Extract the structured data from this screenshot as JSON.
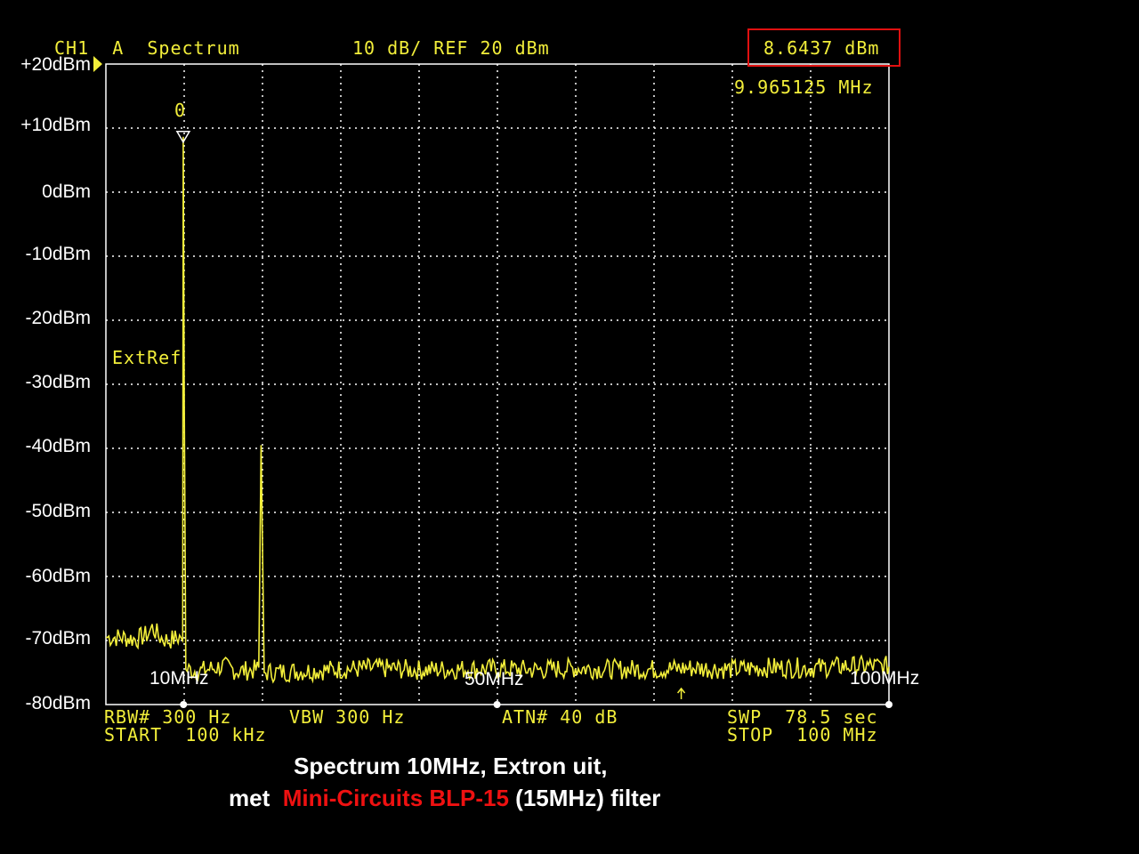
{
  "header": {
    "channel": "CH1",
    "mode": "A",
    "title": "Spectrum",
    "scale": "10 dB/ REF 20 dBm",
    "marker_level": "8.6437 dBm",
    "marker_freq": "9.965125 MHz",
    "marker_label": "0",
    "extref": "ExtRef"
  },
  "footer": {
    "rbw": "RBW# 300 Hz",
    "vbw": "VBW 300 Hz",
    "atn": "ATN# 40 dB",
    "swp": "SWP  78.5 sec",
    "start": "START  100 kHz",
    "stop": "STOP  100 MHz"
  },
  "caption": {
    "line1": "Spectrum 10MHz, Extron uit,",
    "line2_prefix": "met ",
    "line2_highlight": "Mini-Circuits BLP-15",
    "line2_suffix": " (15MHz) filter"
  },
  "colors": {
    "trace": "#f2ee3a",
    "grid": "#ffffff",
    "highlight": "#ee1111",
    "background": "#000000"
  },
  "chart_data": {
    "type": "line",
    "title": "Spectrum",
    "xlabel": "",
    "ylabel": "",
    "xlim": [
      0.1,
      100
    ],
    "ylim": [
      -80,
      20
    ],
    "x_unit": "MHz",
    "y_tick_labels": [
      "+20dBm",
      "+10dBm",
      "0dBm",
      "-10dBm",
      "-20dBm",
      "-30dBm",
      "-40dBm",
      "-50dBm",
      "-60dBm",
      "-70dBm",
      "-80dBm"
    ],
    "y_ticks": [
      20,
      10,
      0,
      -10,
      -20,
      -30,
      -40,
      -50,
      -60,
      -70,
      -80
    ],
    "x_tick_labels": [
      "10MHz",
      "50MHz",
      "100MHz"
    ],
    "x_ticks": [
      10,
      50,
      100
    ],
    "grid": true,
    "series": [
      {
        "points": [
          [
            0.1,
            -69.5
          ],
          [
            2,
            -69.5
          ],
          [
            4,
            -69.8
          ],
          [
            5.5,
            -69
          ],
          [
            6,
            -68
          ],
          [
            7,
            -69.5
          ],
          [
            8,
            -70
          ],
          [
            9.5,
            -69.5
          ],
          [
            9.9,
            -70
          ],
          [
            9.965,
            8.64
          ],
          [
            10.1,
            -33
          ],
          [
            10.3,
            -74.5
          ],
          [
            12,
            -74.8
          ],
          [
            15,
            -74
          ],
          [
            17,
            -74.8
          ],
          [
            19.6,
            -74.5
          ],
          [
            19.9,
            -39.5
          ],
          [
            20.1,
            -57.5
          ],
          [
            20.3,
            -75
          ],
          [
            25,
            -74.8
          ],
          [
            30,
            -74.5
          ],
          [
            35,
            -74.3
          ],
          [
            40,
            -74.6
          ],
          [
            45,
            -74.5
          ],
          [
            50,
            -74.4
          ],
          [
            55,
            -74.6
          ],
          [
            60,
            -74.3
          ],
          [
            65,
            -74.5
          ],
          [
            70,
            -74.5
          ],
          [
            75,
            -74.3
          ],
          [
            80,
            -74.5
          ],
          [
            85,
            -74.2
          ],
          [
            90,
            -74.3
          ],
          [
            95,
            -74.0
          ],
          [
            100,
            -74.0
          ]
        ]
      }
    ]
  }
}
